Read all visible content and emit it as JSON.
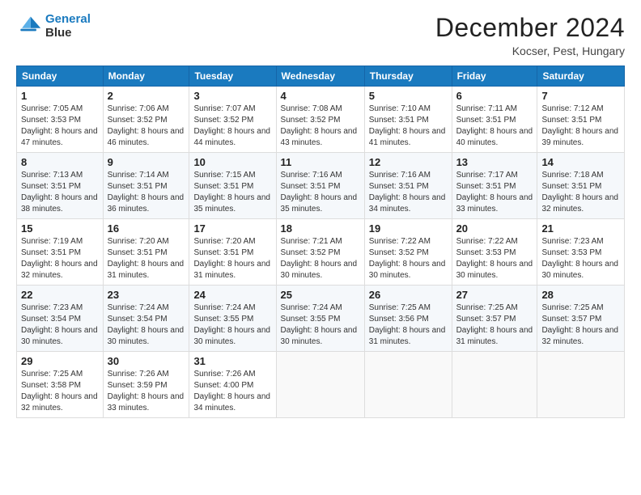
{
  "header": {
    "logo_line1": "General",
    "logo_line2": "Blue",
    "month": "December 2024",
    "location": "Kocser, Pest, Hungary"
  },
  "weekdays": [
    "Sunday",
    "Monday",
    "Tuesday",
    "Wednesday",
    "Thursday",
    "Friday",
    "Saturday"
  ],
  "weeks": [
    [
      {
        "day": 1,
        "sunrise": "7:05 AM",
        "sunset": "3:53 PM",
        "daylight": "8 hours and 47 minutes."
      },
      {
        "day": 2,
        "sunrise": "7:06 AM",
        "sunset": "3:52 PM",
        "daylight": "8 hours and 46 minutes."
      },
      {
        "day": 3,
        "sunrise": "7:07 AM",
        "sunset": "3:52 PM",
        "daylight": "8 hours and 44 minutes."
      },
      {
        "day": 4,
        "sunrise": "7:08 AM",
        "sunset": "3:52 PM",
        "daylight": "8 hours and 43 minutes."
      },
      {
        "day": 5,
        "sunrise": "7:10 AM",
        "sunset": "3:51 PM",
        "daylight": "8 hours and 41 minutes."
      },
      {
        "day": 6,
        "sunrise": "7:11 AM",
        "sunset": "3:51 PM",
        "daylight": "8 hours and 40 minutes."
      },
      {
        "day": 7,
        "sunrise": "7:12 AM",
        "sunset": "3:51 PM",
        "daylight": "8 hours and 39 minutes."
      }
    ],
    [
      {
        "day": 8,
        "sunrise": "7:13 AM",
        "sunset": "3:51 PM",
        "daylight": "8 hours and 38 minutes."
      },
      {
        "day": 9,
        "sunrise": "7:14 AM",
        "sunset": "3:51 PM",
        "daylight": "8 hours and 36 minutes."
      },
      {
        "day": 10,
        "sunrise": "7:15 AM",
        "sunset": "3:51 PM",
        "daylight": "8 hours and 35 minutes."
      },
      {
        "day": 11,
        "sunrise": "7:16 AM",
        "sunset": "3:51 PM",
        "daylight": "8 hours and 35 minutes."
      },
      {
        "day": 12,
        "sunrise": "7:16 AM",
        "sunset": "3:51 PM",
        "daylight": "8 hours and 34 minutes."
      },
      {
        "day": 13,
        "sunrise": "7:17 AM",
        "sunset": "3:51 PM",
        "daylight": "8 hours and 33 minutes."
      },
      {
        "day": 14,
        "sunrise": "7:18 AM",
        "sunset": "3:51 PM",
        "daylight": "8 hours and 32 minutes."
      }
    ],
    [
      {
        "day": 15,
        "sunrise": "7:19 AM",
        "sunset": "3:51 PM",
        "daylight": "8 hours and 32 minutes."
      },
      {
        "day": 16,
        "sunrise": "7:20 AM",
        "sunset": "3:51 PM",
        "daylight": "8 hours and 31 minutes."
      },
      {
        "day": 17,
        "sunrise": "7:20 AM",
        "sunset": "3:51 PM",
        "daylight": "8 hours and 31 minutes."
      },
      {
        "day": 18,
        "sunrise": "7:21 AM",
        "sunset": "3:52 PM",
        "daylight": "8 hours and 30 minutes."
      },
      {
        "day": 19,
        "sunrise": "7:22 AM",
        "sunset": "3:52 PM",
        "daylight": "8 hours and 30 minutes."
      },
      {
        "day": 20,
        "sunrise": "7:22 AM",
        "sunset": "3:53 PM",
        "daylight": "8 hours and 30 minutes."
      },
      {
        "day": 21,
        "sunrise": "7:23 AM",
        "sunset": "3:53 PM",
        "daylight": "8 hours and 30 minutes."
      }
    ],
    [
      {
        "day": 22,
        "sunrise": "7:23 AM",
        "sunset": "3:54 PM",
        "daylight": "8 hours and 30 minutes."
      },
      {
        "day": 23,
        "sunrise": "7:24 AM",
        "sunset": "3:54 PM",
        "daylight": "8 hours and 30 minutes."
      },
      {
        "day": 24,
        "sunrise": "7:24 AM",
        "sunset": "3:55 PM",
        "daylight": "8 hours and 30 minutes."
      },
      {
        "day": 25,
        "sunrise": "7:24 AM",
        "sunset": "3:55 PM",
        "daylight": "8 hours and 30 minutes."
      },
      {
        "day": 26,
        "sunrise": "7:25 AM",
        "sunset": "3:56 PM",
        "daylight": "8 hours and 31 minutes."
      },
      {
        "day": 27,
        "sunrise": "7:25 AM",
        "sunset": "3:57 PM",
        "daylight": "8 hours and 31 minutes."
      },
      {
        "day": 28,
        "sunrise": "7:25 AM",
        "sunset": "3:57 PM",
        "daylight": "8 hours and 32 minutes."
      }
    ],
    [
      {
        "day": 29,
        "sunrise": "7:25 AM",
        "sunset": "3:58 PM",
        "daylight": "8 hours and 32 minutes."
      },
      {
        "day": 30,
        "sunrise": "7:26 AM",
        "sunset": "3:59 PM",
        "daylight": "8 hours and 33 minutes."
      },
      {
        "day": 31,
        "sunrise": "7:26 AM",
        "sunset": "4:00 PM",
        "daylight": "8 hours and 34 minutes."
      },
      null,
      null,
      null,
      null
    ]
  ]
}
